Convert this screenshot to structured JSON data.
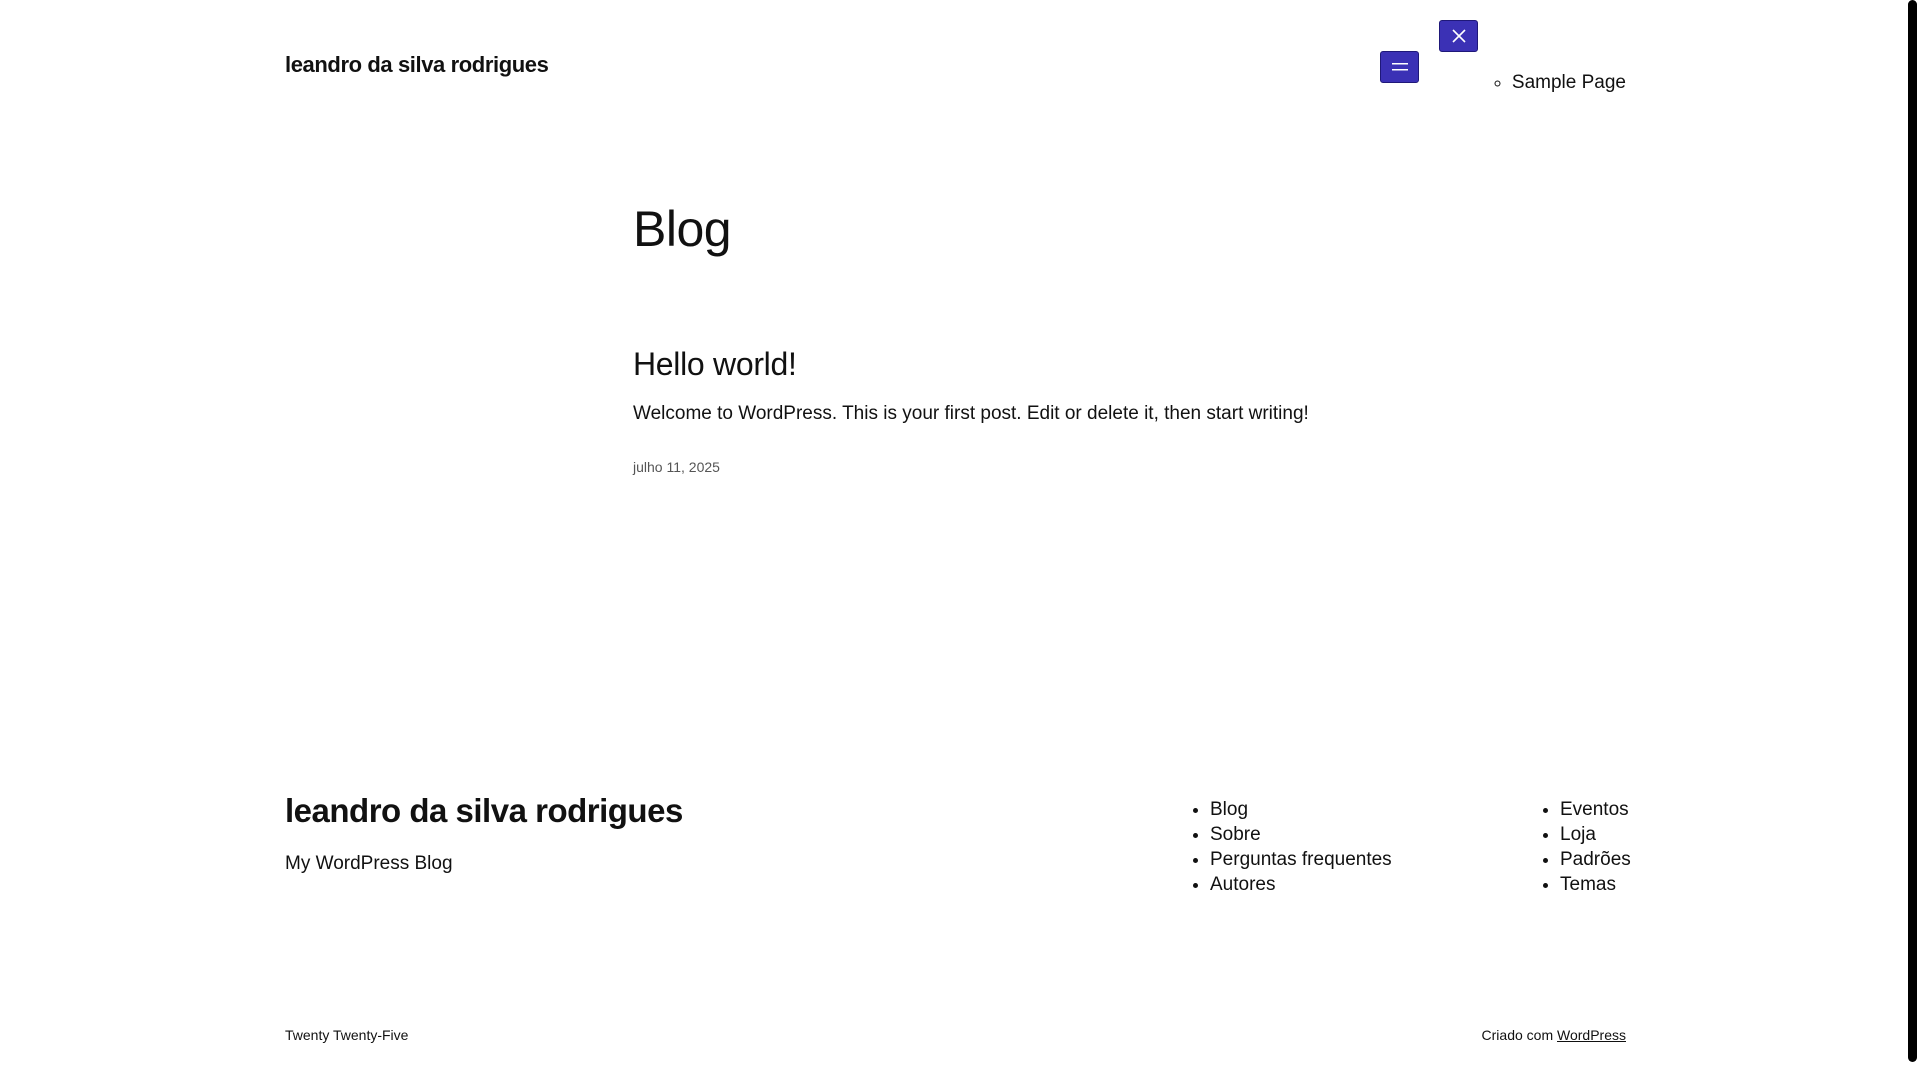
{
  "header": {
    "site_title": "leandro da silva rodrigues",
    "submenu_items": [
      "Sample Page"
    ]
  },
  "main": {
    "page_heading": "Blog",
    "post": {
      "title": "Hello world!",
      "excerpt": "Welcome to WordPress. This is your first post. Edit or delete it, then start writing!",
      "date": "julho 11, 2025"
    }
  },
  "footer": {
    "site_title": "leandro da silva rodrigues",
    "tagline": "My WordPress Blog",
    "menu_1": [
      "Blog",
      "Sobre",
      "Perguntas frequentes",
      "Autores"
    ],
    "menu_2": [
      "Eventos",
      "Loja",
      "Padrões",
      "Temas"
    ],
    "theme_credit": "Twenty Twenty-Five",
    "powered_prefix": "Criado com",
    "powered_link": "WordPress"
  },
  "icons": {
    "open_menu": "hamburger-icon",
    "close_menu": "close-icon"
  },
  "colors": {
    "accent_button": "#3b31b5",
    "text": "#111111",
    "muted_text": "#555555"
  }
}
